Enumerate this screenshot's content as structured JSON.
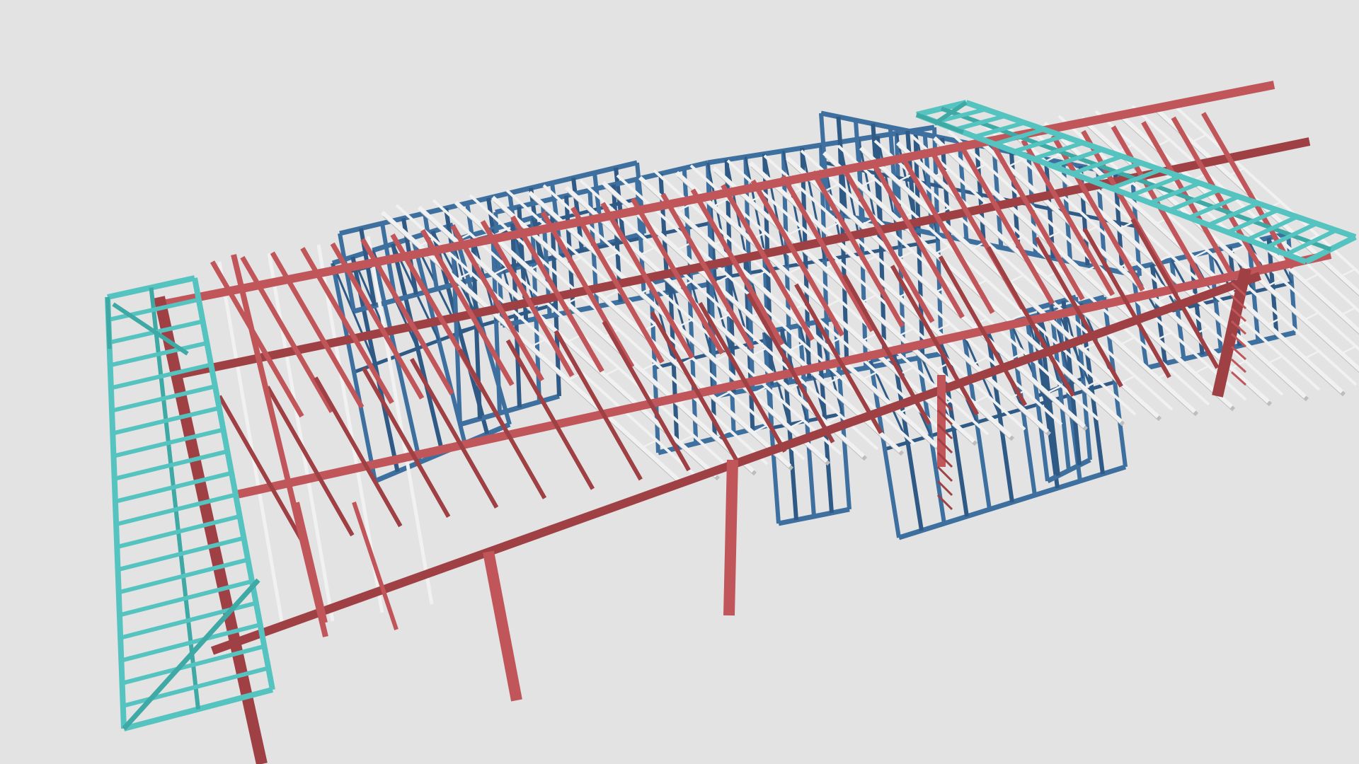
{
  "viewer": {
    "background_color": "#e3e3e3"
  },
  "model": {
    "colors": {
      "wall_frame": "#3d6f9f",
      "wall_frame_dark": "#2f5a86",
      "beam": "#c0565a",
      "beam_dark": "#9e4044",
      "truss": "#f1f1f1",
      "truss_shadow": "#bdbdbd",
      "canopy": "#55c4c0",
      "canopy_dark": "#3ea9a5"
    },
    "members": [
      "wall-frame",
      "steel-beam",
      "roof-truss",
      "canopy-frame",
      "post"
    ]
  }
}
